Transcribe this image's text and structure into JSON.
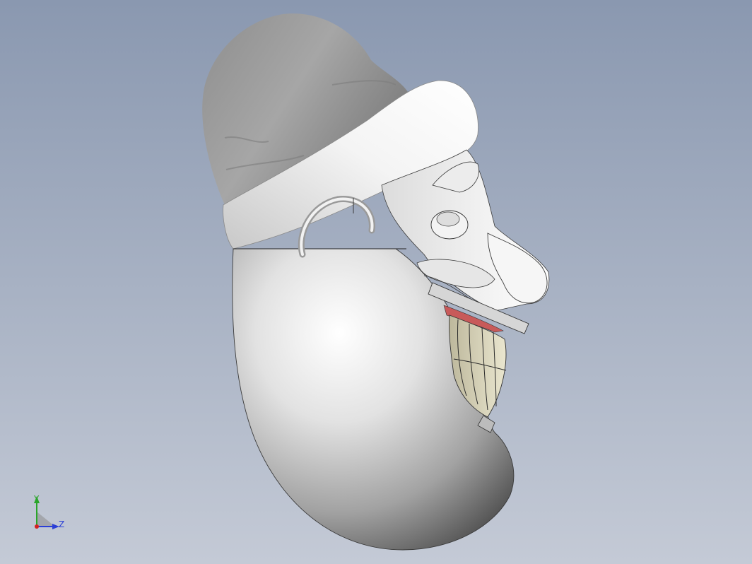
{
  "viewport": {
    "background_top": "#8a98b0",
    "background_bottom": "#c4cad6",
    "model_name": "cartoon-head-with-beanie-and-beard"
  },
  "triad": {
    "y_label": "Y",
    "z_label": "Z",
    "y_color": "#2aa52a",
    "z_color": "#2b3fd6",
    "x_color": "#d42020"
  }
}
